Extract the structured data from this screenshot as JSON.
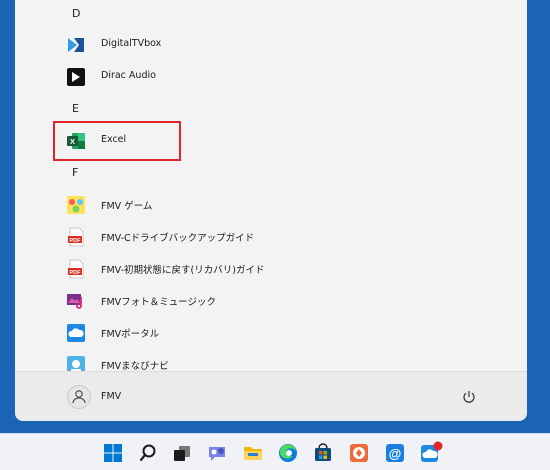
{
  "start_menu": {
    "sections": [
      {
        "letter": "D",
        "apps": [
          {
            "label": "DigitalTVbox",
            "icon": "digitaltvbox-icon"
          },
          {
            "label": "Dirac Audio",
            "icon": "dirac-audio-icon"
          }
        ]
      },
      {
        "letter": "E",
        "apps": [
          {
            "label": "Excel",
            "icon": "excel-icon"
          }
        ]
      },
      {
        "letter": "F",
        "apps": [
          {
            "label": "FMV ゲーム",
            "icon": "fmv-game-icon"
          },
          {
            "label": "FMV-Cドライブバックアップガイド",
            "icon": "pdf-icon"
          },
          {
            "label": "FMV-初期状態に戻す(リカバリ)ガイド",
            "icon": "pdf-icon"
          },
          {
            "label": "FMVフォト＆ミュージック",
            "icon": "photo-music-icon"
          },
          {
            "label": "FMVポータル",
            "icon": "fmv-portal-icon"
          },
          {
            "label": "FMVまなびナビ",
            "icon": "manabi-navi-icon"
          }
        ]
      }
    ],
    "user": {
      "name": "FMV"
    }
  },
  "colors": {
    "desktop": "#1a63b5",
    "highlight": "#e0242b",
    "excel": "#1d7044"
  },
  "taskbar": {
    "icons": [
      "windows-start-icon",
      "search-icon",
      "task-view-icon",
      "chat-icon",
      "file-explorer-icon",
      "edge-icon",
      "store-icon",
      "app-icon",
      "mail-icon",
      "notification-app-icon"
    ]
  }
}
